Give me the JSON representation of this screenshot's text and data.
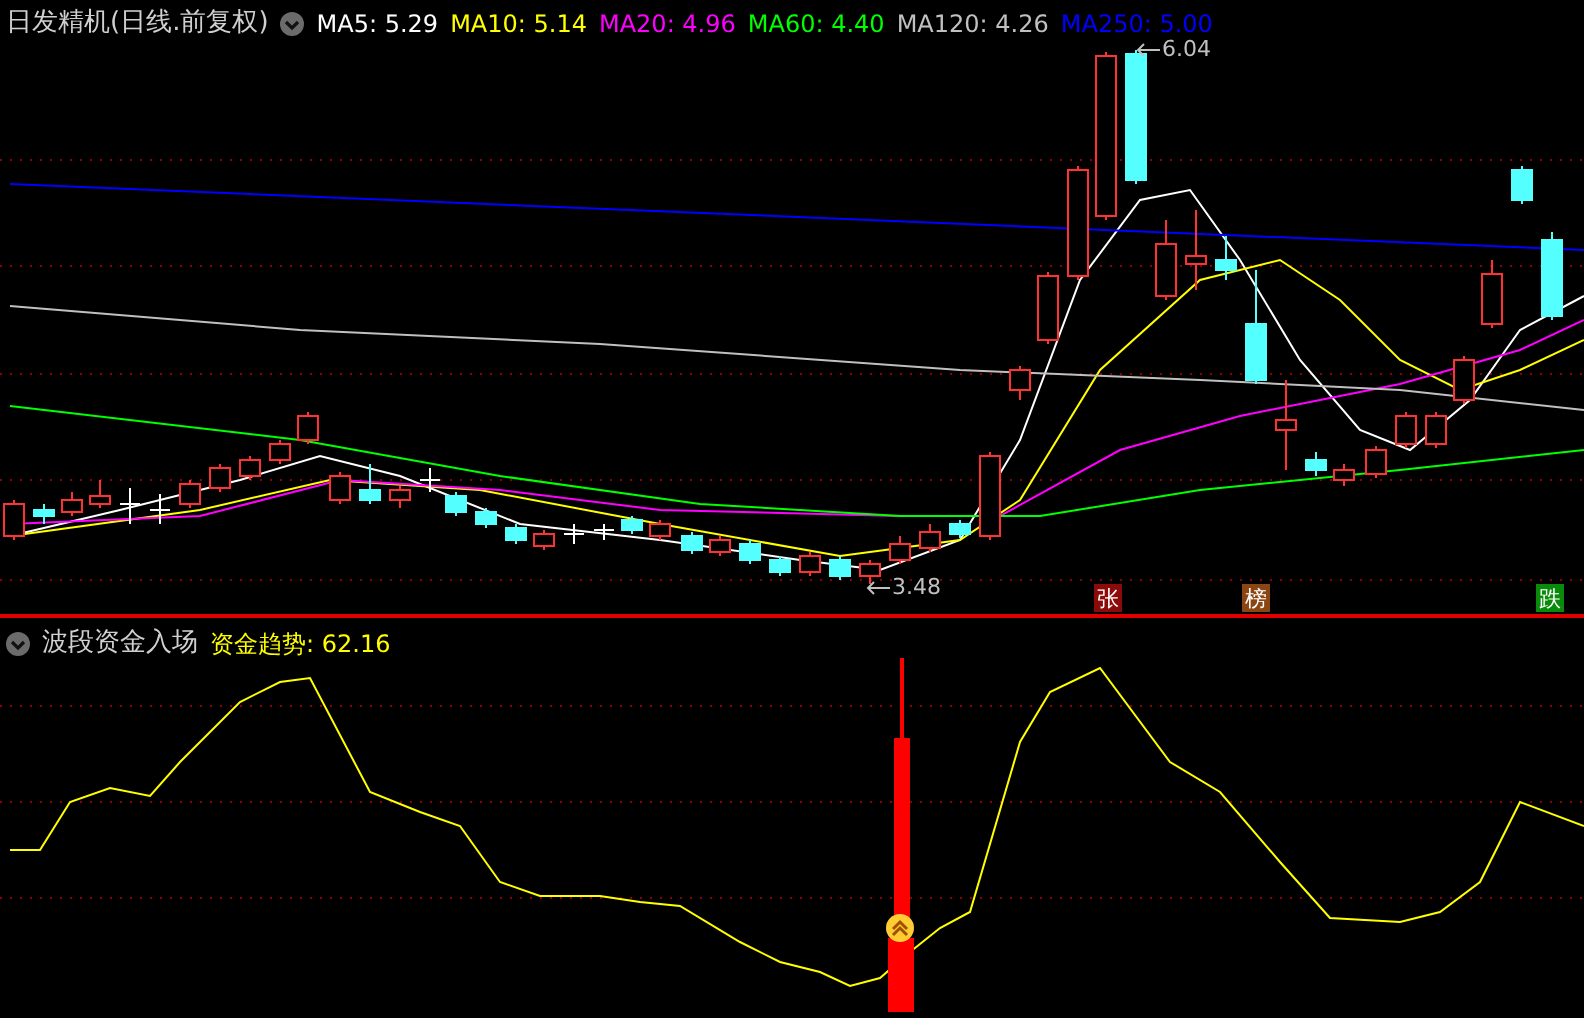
{
  "price_panel": {
    "title": "日发精机(日线.前复权)",
    "ma_legend": [
      {
        "text": "MA5: 5.29",
        "color": "#ffffff"
      },
      {
        "text": "MA10: 5.14",
        "color": "#ffff00"
      },
      {
        "text": "MA20: 4.96",
        "color": "#ff00ff"
      },
      {
        "text": "MA60: 4.40",
        "color": "#00ff00"
      },
      {
        "text": "MA120: 4.26",
        "color": "#c0c0c0"
      },
      {
        "text": "MA250: 5.00",
        "color": "#0000ff"
      }
    ],
    "annotations": [
      {
        "text": "6.04",
        "kind": "high"
      },
      {
        "text": "3.48",
        "kind": "low"
      }
    ],
    "badges": [
      {
        "text": "张",
        "color": "#8b0a0a"
      },
      {
        "text": "榜",
        "color": "#8b4513"
      },
      {
        "text": "跌",
        "color": "#0a8a0a"
      }
    ]
  },
  "indicator_panel": {
    "title": "波段资金入场",
    "legend": [
      {
        "text": "资金趋势: 62.16",
        "color": "#ffff00"
      }
    ]
  }
}
